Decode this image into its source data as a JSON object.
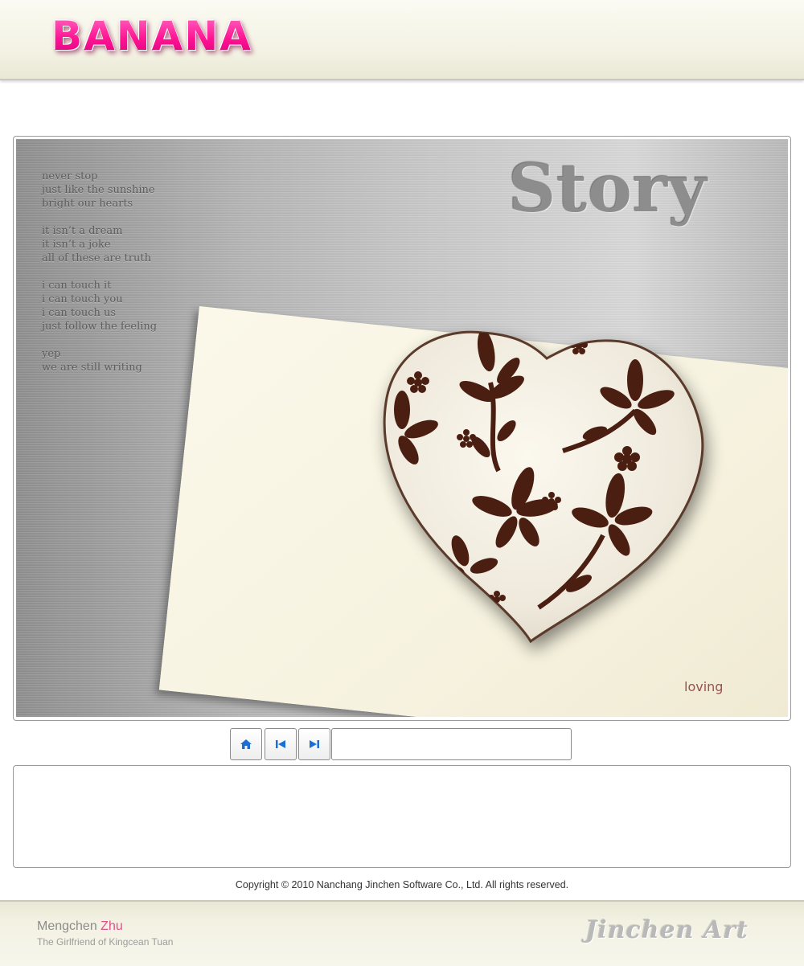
{
  "header": {
    "logo_text": "BANANA"
  },
  "stage": {
    "title": "Story",
    "poem": [
      [
        "never stop",
        "just like the sunshine",
        "bright our hearts"
      ],
      [
        "it isn’t a dream",
        "it isn’t a joke",
        "all of these are truth"
      ],
      [
        "i can touch it",
        "i can touch you",
        "i can touch us",
        "just follow the feeling"
      ],
      [
        "yep",
        "we are still writing"
      ]
    ],
    "photo_caption": "loving"
  },
  "controls": {
    "home_icon": "home-icon",
    "prev_icon": "skip-previous-icon",
    "next_icon": "skip-next-icon",
    "caption_value": "",
    "accent_color": "#1a6fd6"
  },
  "description": {
    "text": ""
  },
  "copyright": "Copyright © 2010 Nanchang Jinchen Software Co., Ltd. All rights reserved.",
  "footer": {
    "author_first": "Mengchen",
    "author_last": "Zhu",
    "tagline": "The Girlfriend of Kingcean Tuan",
    "brand": "Jinchen Art"
  },
  "colors": {
    "logo_pink": "#ff1493",
    "author_last_pink": "#e0508f",
    "caption_red": "#9a5050"
  }
}
